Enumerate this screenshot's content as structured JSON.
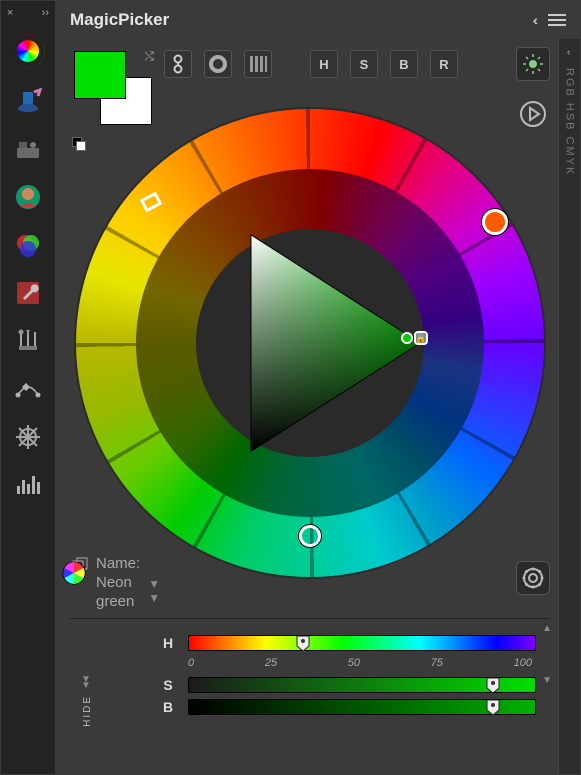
{
  "app": {
    "title": "MagicPicker"
  },
  "header": {
    "collapse_glyph": "‹‹",
    "menu_label": "menu"
  },
  "side_rail": {
    "collapse_glyph": "››",
    "modes_text": "RGB HSB CMYK"
  },
  "swatches": {
    "fg": "#00e000",
    "bg": "#ffffff"
  },
  "mode_buttons": {
    "h": "H",
    "s": "S",
    "b": "B",
    "r": "R"
  },
  "name_block": {
    "label": "Name:",
    "line1": "Neon",
    "line2": "green"
  },
  "sliders": {
    "scale": {
      "v0": "0",
      "v25": "25",
      "v50": "50",
      "v75": "75",
      "v100": "100"
    },
    "h": {
      "label": "H",
      "pos": 33
    },
    "s": {
      "label": "S",
      "pos": 88
    },
    "b": {
      "label": "B",
      "pos": 88
    },
    "hide": "HIDE"
  },
  "left_rail": {
    "close": "×",
    "expand": "››",
    "items": [
      "magic-hat",
      "hardware",
      "palette-face",
      "rgb-venn",
      "wrench",
      "brushes",
      "pen-curve",
      "ship-wheel",
      "equalizer"
    ]
  }
}
